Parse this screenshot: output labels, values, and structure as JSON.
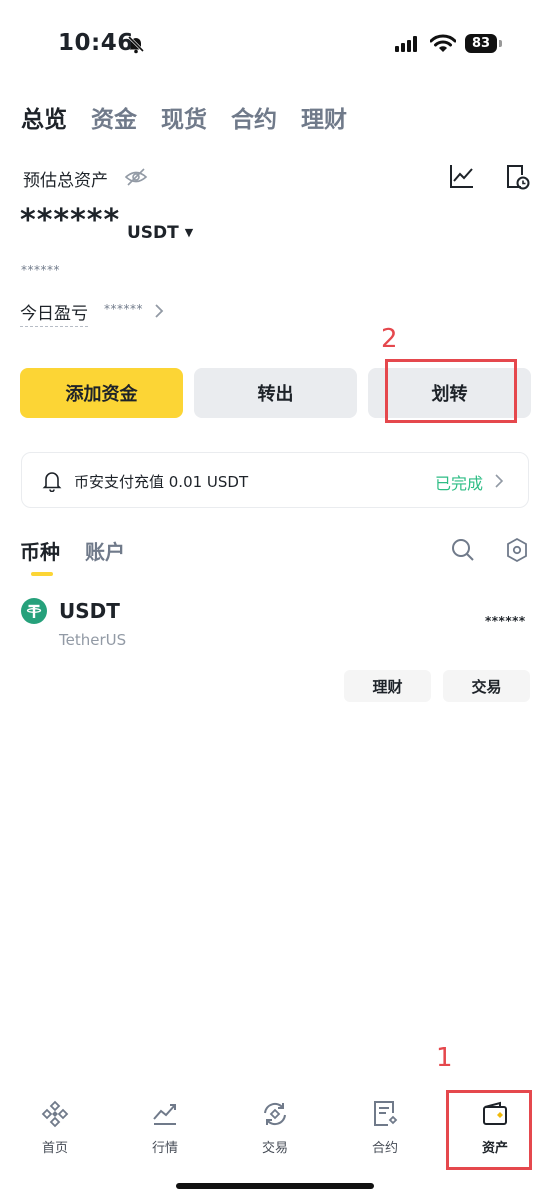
{
  "status_bar": {
    "time": "10:46",
    "battery": "83"
  },
  "top_tabs": [
    "总览",
    "资金",
    "现货",
    "合约",
    "理财"
  ],
  "total_assets": {
    "label": "预估总资产",
    "masked_value": "******",
    "currency": "USDT",
    "masked_sub": "******"
  },
  "pnl": {
    "label": "今日盈亏",
    "masked_value": "******"
  },
  "actions": {
    "deposit": "添加资金",
    "withdraw": "转出",
    "transfer": "划转"
  },
  "notice": {
    "text": "币安支付充值 0.01 USDT",
    "status": "已完成",
    "status_color": "#2ebd85"
  },
  "section_tabs": [
    "币种",
    "账户"
  ],
  "assets": [
    {
      "symbol": "USDT",
      "name": "TetherUS",
      "masked_balance": "******",
      "buttons": [
        "理财",
        "交易"
      ]
    }
  ],
  "bottom_nav": [
    "首页",
    "行情",
    "交易",
    "合约",
    "资产"
  ],
  "annotations": [
    "1",
    "2"
  ],
  "colors": {
    "accent": "#fcd535",
    "annotation": "#e5484d",
    "tether": "#26a17b"
  },
  "icons": [
    "bell-off-icon",
    "signal-icon",
    "wifi-icon",
    "eye-off-icon",
    "chart-icon",
    "history-icon",
    "bell-icon",
    "search-icon",
    "settings-icon",
    "home-icon",
    "markets-icon",
    "trade-icon",
    "futures-icon",
    "wallet-icon"
  ]
}
